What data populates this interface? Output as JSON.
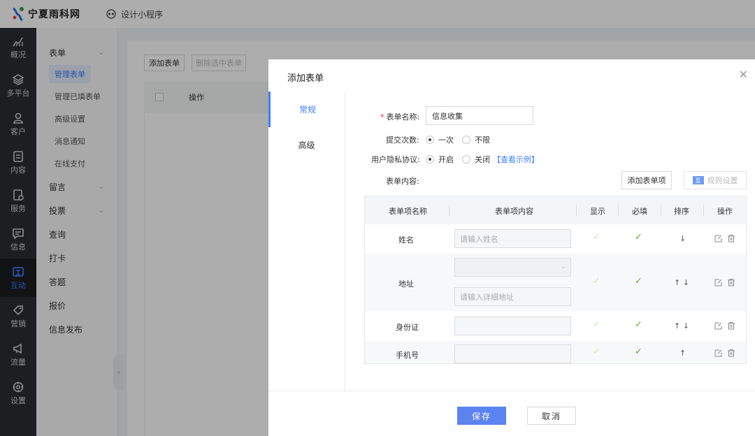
{
  "topbar": {
    "brand": "宁夏雨科网",
    "mini_program": "设计小程序"
  },
  "rail": [
    {
      "icon": "chart-icon",
      "label": "概况"
    },
    {
      "icon": "layers-icon",
      "label": "多平台"
    },
    {
      "icon": "user-icon",
      "label": "客户"
    },
    {
      "icon": "document-icon",
      "label": "内容"
    },
    {
      "icon": "service-icon",
      "label": "服务"
    },
    {
      "icon": "message-icon",
      "label": "信息"
    },
    {
      "icon": "interact-icon",
      "label": "互动",
      "active": true
    },
    {
      "icon": "tag-icon",
      "label": "营销"
    },
    {
      "icon": "megaphone-icon",
      "label": "流量"
    },
    {
      "icon": "settings-icon",
      "label": "设置"
    }
  ],
  "submenu": {
    "group_form": "表单",
    "form_items": [
      "管理表单",
      "管理已填表单",
      "高级设置",
      "消息通知",
      "在线支付"
    ],
    "group_message": "留言",
    "group_vote": "投票",
    "plain_items": [
      "查询",
      "打卡",
      "答题",
      "报价",
      "信息发布"
    ]
  },
  "background": {
    "add_form": "添加表单",
    "delete_selected": "删除选中表单",
    "op_header": "操作"
  },
  "modal": {
    "title": "添加表单",
    "tabs": [
      "常规",
      "高级"
    ],
    "form_name_label": "表单名称:",
    "form_name_value": "信息收集",
    "submit_count_label": "提交次数:",
    "submit_options": [
      "一次",
      "不限"
    ],
    "privacy_label": "用户隐私协议:",
    "privacy_options": [
      "开启",
      "关闭"
    ],
    "view_example": "【查看示例】",
    "content_label": "表单内容:",
    "add_item_button": "添加表单项",
    "rule_icon_text": "互",
    "rule_button": "规则设置",
    "table": {
      "headers": [
        "表单项名称",
        "表单项内容",
        "显示",
        "必填",
        "排序",
        "操作"
      ],
      "rows": [
        {
          "name": "姓名",
          "placeholder": "请输入姓名",
          "sort": "↓"
        },
        {
          "name": "地址",
          "placeholder": "",
          "placeholder2": "请输入详细地址",
          "sort": "↑ ↓"
        },
        {
          "name": "身份证",
          "placeholder": "",
          "sort": "↑ ↓"
        },
        {
          "name": "手机号",
          "placeholder": "",
          "sort": "↑"
        }
      ]
    },
    "save": "保存",
    "cancel": "取消"
  },
  "colors": {
    "accent": "#3d7eff",
    "primary_button": "#5b84f0",
    "check_green": "#52b32a",
    "rail_bg": "#2a2d33"
  }
}
